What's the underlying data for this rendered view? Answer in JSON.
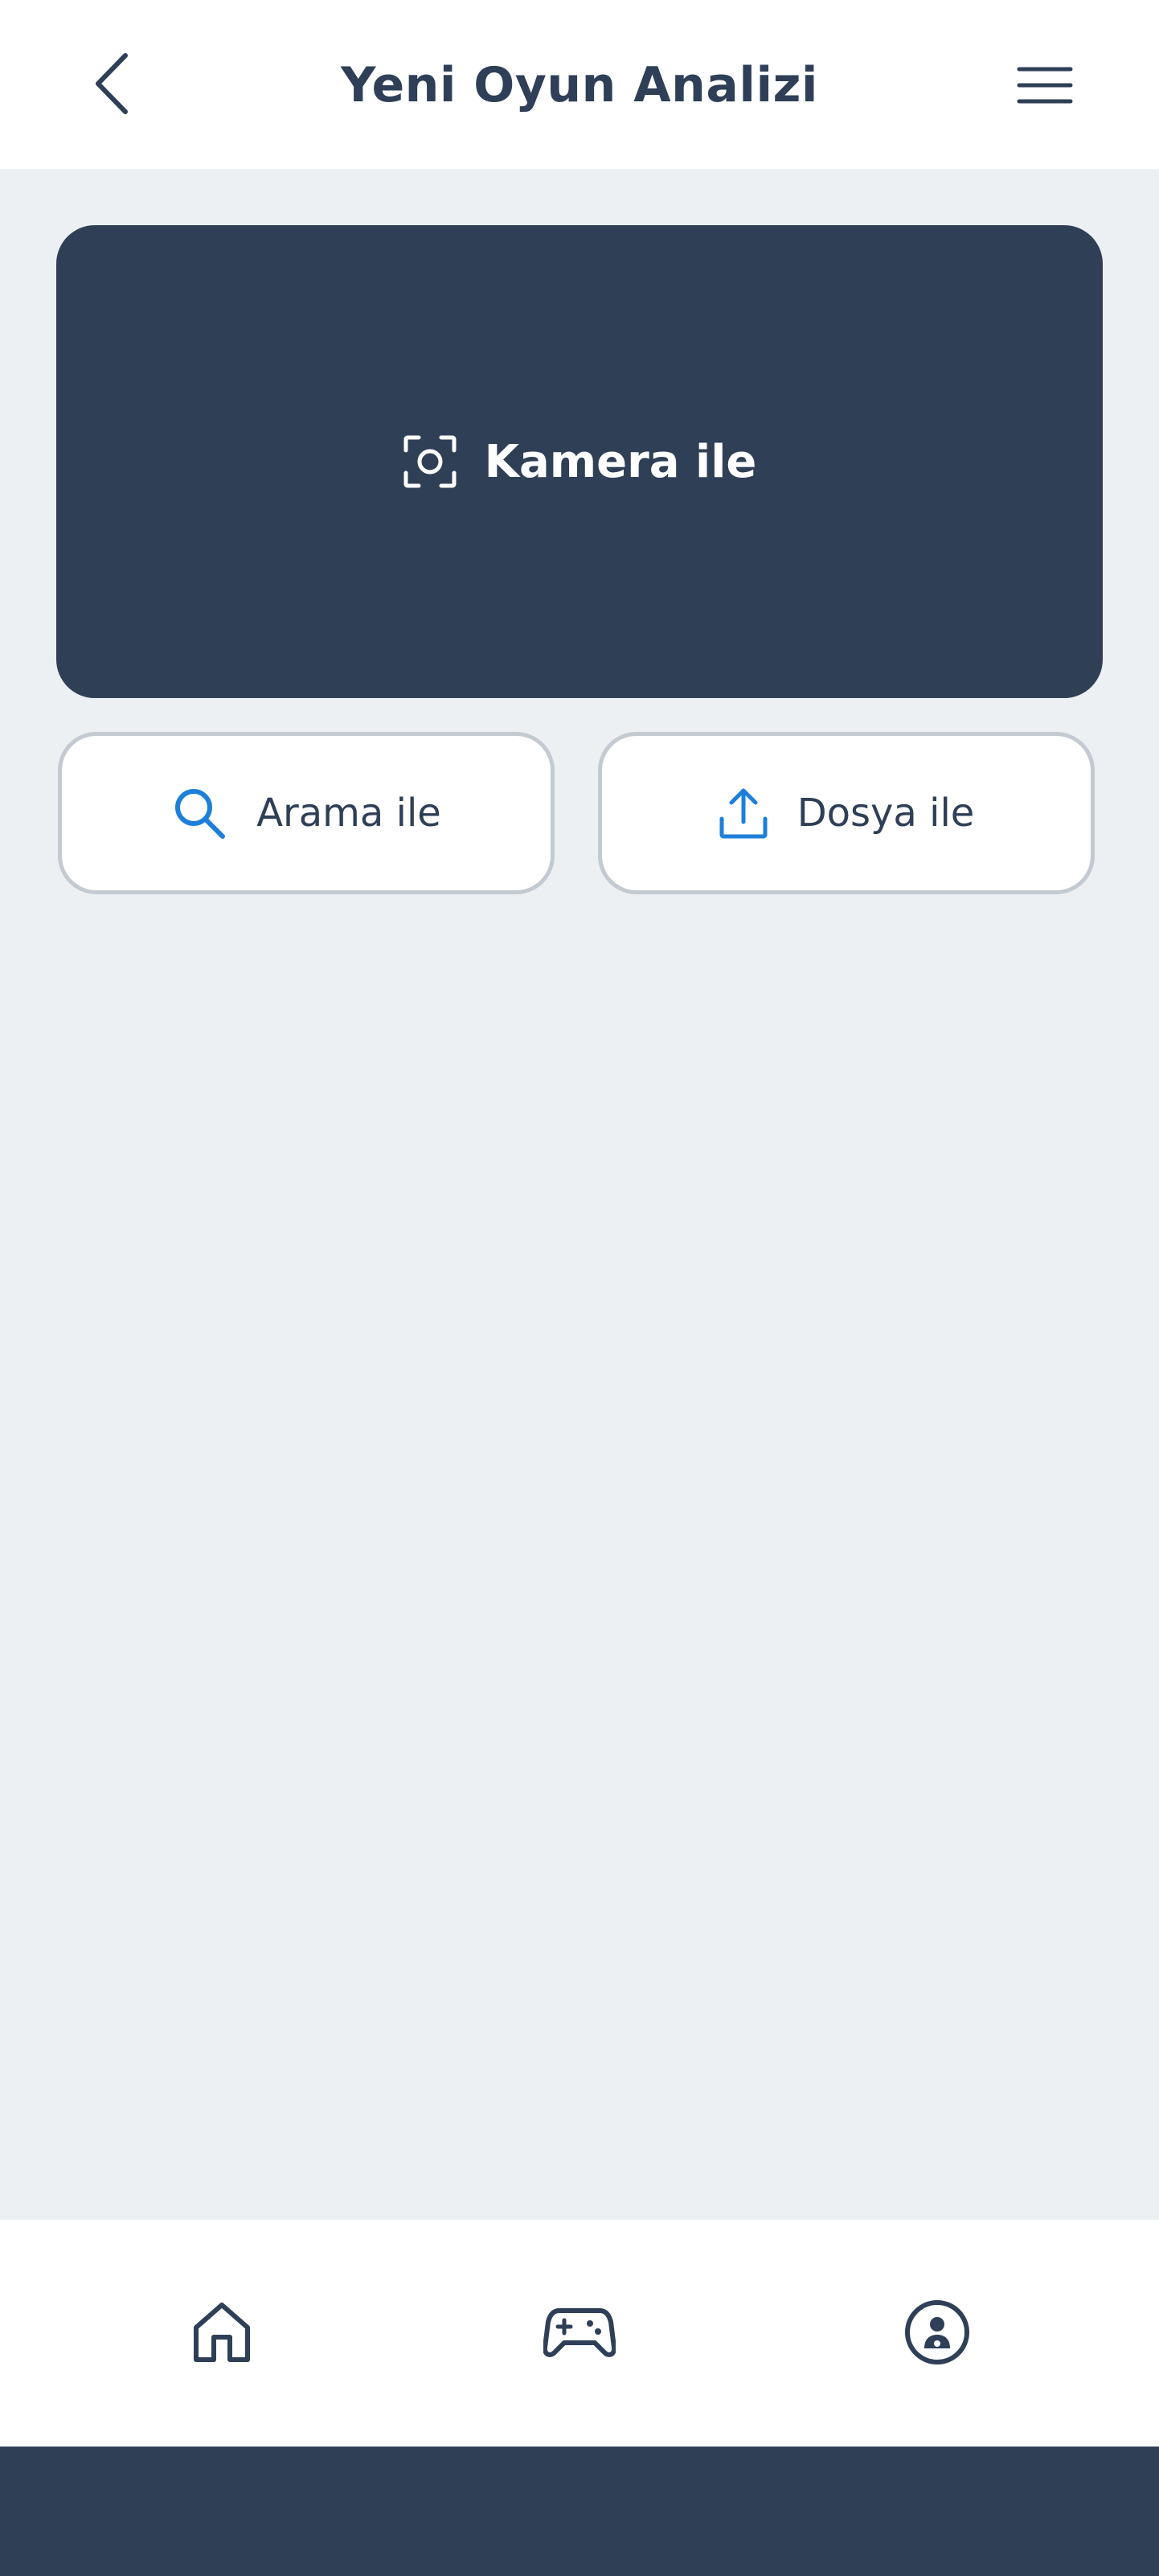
{
  "header": {
    "title": "Yeni Oyun Analizi",
    "back_icon": "chevron-left-icon",
    "menu_icon": "hamburger-menu-icon"
  },
  "camera_option": {
    "label": "Kamera ile",
    "icon": "camera-scan-icon"
  },
  "search_option": {
    "label": "Arama ile",
    "icon": "search-icon"
  },
  "file_option": {
    "label": "Dosya ile",
    "icon": "upload-icon"
  },
  "bottom_nav": {
    "items": [
      {
        "id": "home",
        "icon": "home-icon"
      },
      {
        "id": "games",
        "icon": "gamepad-icon"
      },
      {
        "id": "profile",
        "icon": "profile-icon"
      }
    ]
  },
  "colors": {
    "primary_dark": "#2F3F56",
    "accent_blue": "#1E7FDB",
    "background": "#ECF0F3",
    "border": "#C3CAD1",
    "white": "#FFFFFF"
  }
}
